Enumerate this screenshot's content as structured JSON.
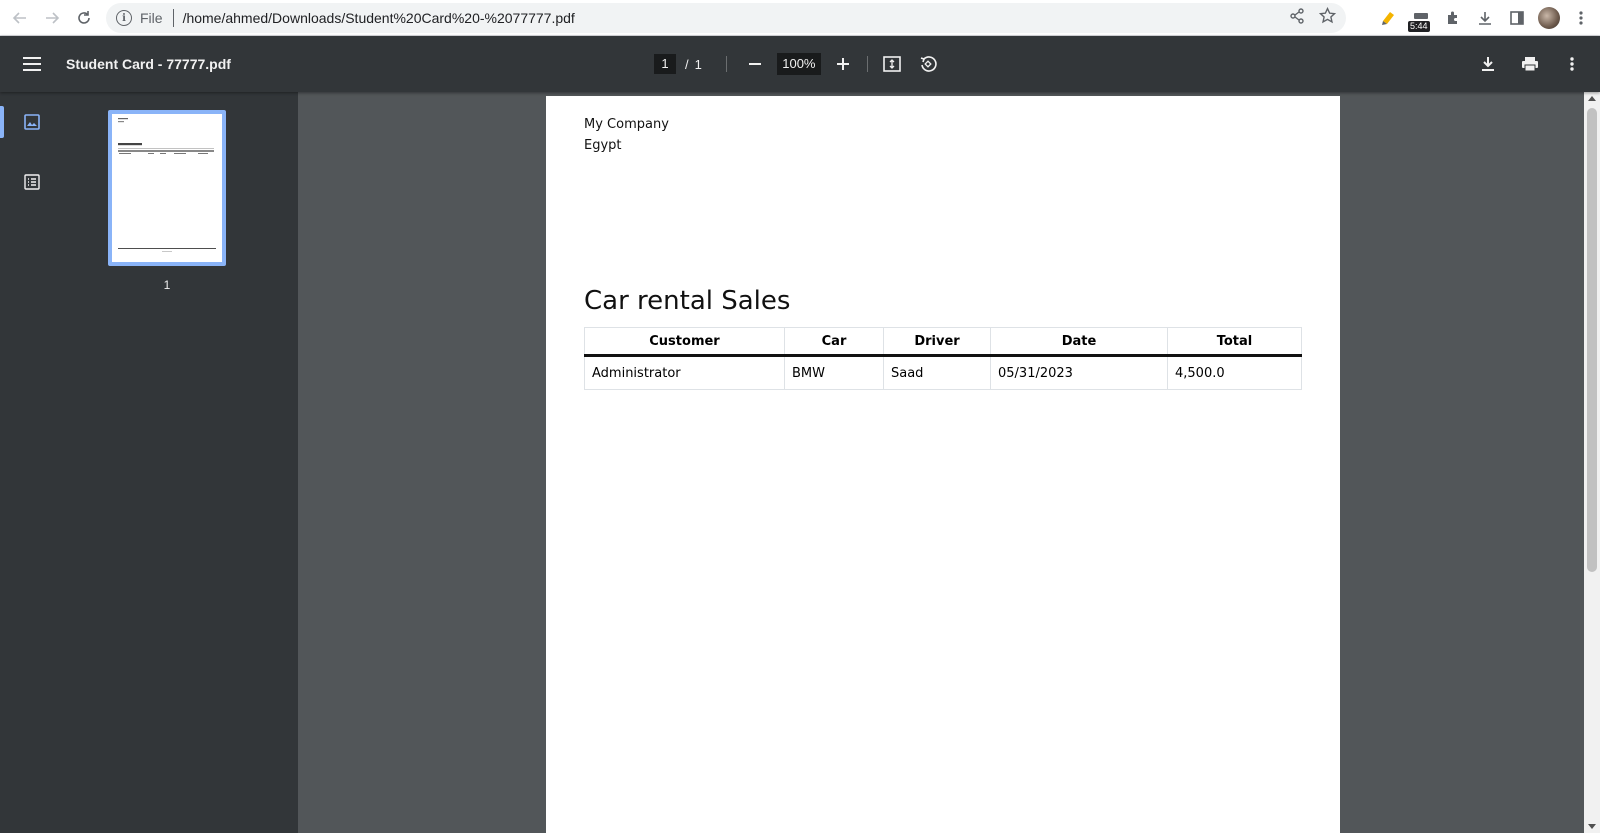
{
  "browser": {
    "scheme_label": "File",
    "url": "/home/ahmed/Downloads/Student%20Card%20-%2077777.pdf",
    "timer_badge": "5:44"
  },
  "toolbar": {
    "title": "Student Card - 77777.pdf",
    "current_page": "1",
    "page_separator": "/",
    "total_pages": "1",
    "zoom": "100%"
  },
  "sidebar": {
    "thumbnail_label": "1"
  },
  "document": {
    "company_name": "My Company",
    "company_country": "Egypt",
    "title": "Car rental Sales",
    "table": {
      "headers": [
        "Customer",
        "Car",
        "Driver",
        "Date",
        "Total"
      ],
      "rows": [
        [
          "Administrator",
          "BMW",
          "Saad",
          "05/31/2023",
          "4,500.0"
        ]
      ]
    }
  },
  "colors": {
    "toolbar_bg": "#323639",
    "viewer_bg": "#525659",
    "accent": "#8ab4f8"
  }
}
